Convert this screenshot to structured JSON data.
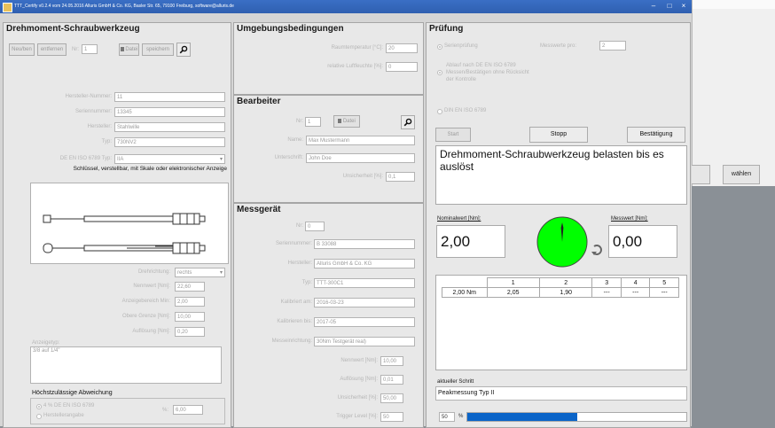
{
  "titlebar": {
    "text": "TTT_Certify v0.2.4 vom 24.05.2016 Alluris GmbH & Co. KG, Basler Str. 65, 79100 Freiburg, software@alluris.de"
  },
  "background_window": {
    "button_left": "",
    "button_right": "wählen"
  },
  "tool": {
    "title": "Drehmoment-Schraubwerkzeug",
    "buttons": {
      "new": "Neu/ben",
      "delete": "entfernen",
      "nr_label": "Nr:",
      "nr_value": "1",
      "file": "Datei",
      "save": "speichern"
    },
    "fields": [
      {
        "label": "Hersteller-Nummer:",
        "value": "11"
      },
      {
        "label": "Seriennummer:",
        "value": "13345"
      },
      {
        "label": "Hersteller:",
        "value": "Stahlwille"
      },
      {
        "label": "Typ:",
        "value": "730NV2"
      }
    ],
    "class_label": "DE EN ISO 6789 Typ:",
    "class_value": "IIA",
    "description": "Schlüssel, verstellbar, mit Skale oder elektronischer Anzeige",
    "direction_label": "Drehrichtung:",
    "direction_value": "rechts",
    "params": [
      {
        "label": "Nennwert [Nm]:",
        "value": "22,60"
      },
      {
        "label": "Anzeigebereich Min:",
        "value": "2,00"
      },
      {
        "label": "Obere Grenze [Nm]:",
        "value": "10,00"
      },
      {
        "label": "Auflösung [Nm]:",
        "value": "0,20"
      }
    ],
    "notes_label": "Anzeigetyp:",
    "notes_value": "3/8 auf 1/4\"",
    "tol_title": "Höchstzulässige Abweichung",
    "tol_opt1": "4 % DE EN ISO 6789",
    "tol_opt2": "Herstellerangabe",
    "tol_value_label": "%:",
    "tol_value": "6,00"
  },
  "env": {
    "title": "Umgebungsbedingungen",
    "fields": [
      {
        "label": "Raumtemperatur [°C]:",
        "value": "20"
      },
      {
        "label": "relative Luftfeuchte [%]:",
        "value": "0"
      }
    ]
  },
  "operator": {
    "title": "Bearbeiter",
    "nr_label": "Nr:",
    "nr_value": "1",
    "file": "Datei",
    "fields": [
      {
        "label": "Name:",
        "value": "Max Mustermann"
      },
      {
        "label": "Unterschrift:",
        "value": "John Doe"
      },
      {
        "label": "Unsicherheit [%]:",
        "value": "0,1"
      }
    ]
  },
  "device": {
    "title": "Messgerät",
    "nr_label": "Nr:",
    "nr_value": "0",
    "fields": [
      {
        "label": "Seriennummer:",
        "value": "B 33088"
      },
      {
        "label": "Hersteller:",
        "value": "Alluris GmbH & Co. KG"
      },
      {
        "label": "Typ:",
        "value": "TTT-300C1"
      },
      {
        "label": "Kalibriert am:",
        "value": "2016-03-23"
      },
      {
        "label": "Kalibrieren bis:",
        "value": "2017-05"
      },
      {
        "label": "Messeinrichtung:",
        "value": "30Nm Testgerät real)"
      }
    ],
    "small": [
      {
        "label": "Nennwert [Nm]:",
        "value": "10,00"
      },
      {
        "label": "Auflösung [Nm]:",
        "value": "0,01"
      },
      {
        "label": "Unsicherheit [%]:",
        "value": "50,00"
      },
      {
        "label": "Trigger Level [%]:",
        "value": "50"
      }
    ]
  },
  "test": {
    "title": "Prüfung",
    "mode_label": "Serienprüfung",
    "count_label": "Messwerte pro:",
    "count_value": "2",
    "opt_auto": "Ablauf nach DE EN ISO 6789",
    "opt_auto2": "Messen/Bestätigen ohne Rücksicht",
    "opt_auto3": "der Kontrolle",
    "opt_manual": "DIN EN ISO 6789",
    "btn_start": "Start",
    "btn_stop": "Stopp",
    "btn_confirm": "Bestätigung",
    "instruction": "Drehmoment-Schraubwerkzeug belasten bis es auslöst",
    "nominal_label": "Nominalwert [Nm]:",
    "nominal_value": "2,00",
    "measured_label": "Messwert [Nm]:",
    "measured_value": "0,00",
    "table": {
      "cols": [
        "1",
        "2",
        "3",
        "4",
        "5"
      ],
      "row_label": "2,00 Nm",
      "cells": [
        "2,05",
        "1,90",
        "---",
        "---",
        "---"
      ]
    },
    "step_label": "aktueller Schritt",
    "step_value": "Peakmessung Typ II",
    "progress_value": "50",
    "progress_unit": "%",
    "progress_fraction": 0.5
  }
}
